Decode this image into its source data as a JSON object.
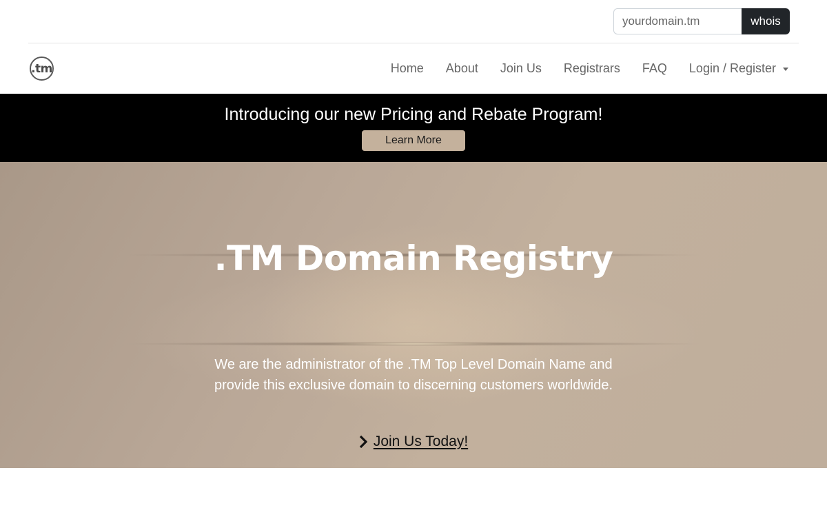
{
  "whois": {
    "placeholder": "yourdomain.tm",
    "button_label": "whois"
  },
  "brand": {
    "logo_text": ".tm"
  },
  "nav": {
    "items": [
      {
        "label": "Home"
      },
      {
        "label": "About"
      },
      {
        "label": "Join Us"
      },
      {
        "label": "Registrars"
      },
      {
        "label": "FAQ"
      }
    ],
    "account_label": "Login / Register"
  },
  "promo": {
    "title": "Introducing our new Pricing and Rebate Program!",
    "button_label": "Learn More"
  },
  "hero": {
    "title": ".TM Domain Registry",
    "description": "We are the administrator of the .TM Top Level Domain Name and provide this exclusive domain to discerning customers worldwide.",
    "cta_label": "Join Us Today!"
  },
  "colors": {
    "promo_background": "#000000",
    "promo_button": "#c4b19c",
    "whois_button": "#212529",
    "hero_tone": "#bcaa98"
  },
  "icons": [
    "tm-logo-icon",
    "caret-down-icon",
    "chevron-right-icon"
  ]
}
